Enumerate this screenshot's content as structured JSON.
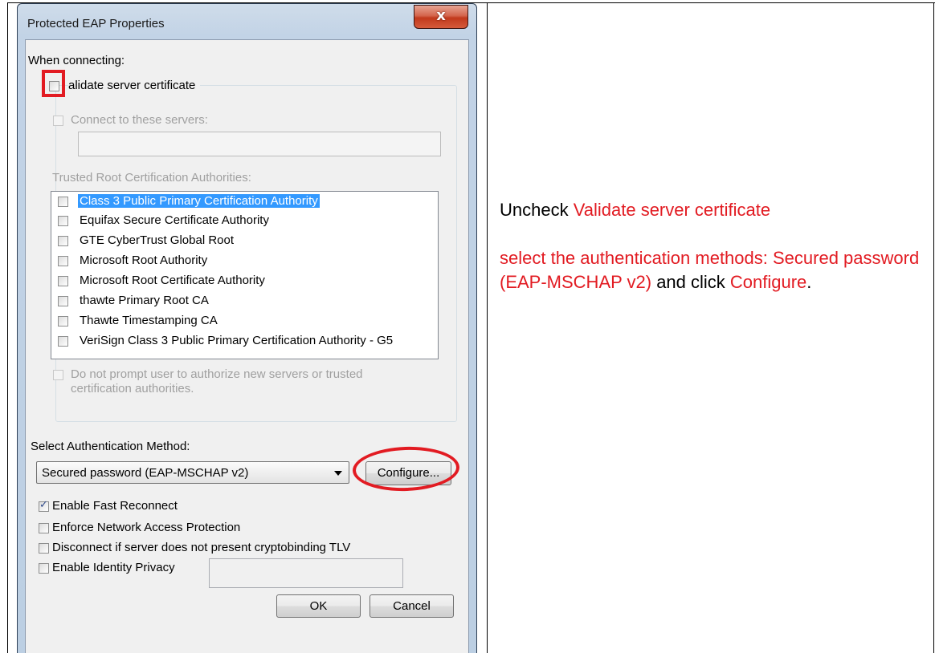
{
  "dialog": {
    "title": "Protected EAP Properties",
    "close_glyph": "x",
    "when_connecting": "When connecting:",
    "validate_cert": {
      "label": "alidate server certificate",
      "checked": false
    },
    "connect_servers": {
      "label": "Connect to these servers:",
      "value": ""
    },
    "trusted_ca_label": "Trusted Root Certification Authorities:",
    "ca_list": [
      {
        "label": "Class 3 Public Primary Certification Authority",
        "checked": false,
        "selected": true
      },
      {
        "label": "Equifax Secure Certificate Authority",
        "checked": false
      },
      {
        "label": "GTE CyberTrust Global Root",
        "checked": false
      },
      {
        "label": "Microsoft Root Authority",
        "checked": false
      },
      {
        "label": "Microsoft Root Certificate Authority",
        "checked": false
      },
      {
        "label": "thawte Primary Root CA",
        "checked": false
      },
      {
        "label": "Thawte Timestamping CA",
        "checked": false
      },
      {
        "label": "VeriSign Class 3 Public Primary Certification Authority - G5",
        "checked": false
      }
    ],
    "no_prompt_line1": "Do not prompt user to authorize new servers or trusted",
    "no_prompt_line2": "certification authorities.",
    "select_method_label": "Select Authentication Method:",
    "method_value": "Secured password (EAP-MSCHAP v2)",
    "configure_label": "Configure...",
    "fast_reconnect": {
      "label": "Enable Fast Reconnect",
      "checked": true
    },
    "enforce_nap": {
      "label": "Enforce Network Access Protection",
      "checked": false
    },
    "disconnect_tlv": {
      "label": "Disconnect if server does not present cryptobinding TLV",
      "checked": false
    },
    "identity_privacy": {
      "label": "Enable Identity Privacy",
      "checked": false,
      "value": ""
    },
    "ok_label": "OK",
    "cancel_label": "Cancel"
  },
  "instructions": {
    "p1_prefix": "Uncheck ",
    "p1_highlight": "Validate server certificate",
    "p2_highlight": "select the authentication methods: Secured password (EAP-MSCHAP v2)",
    "p2_mid": " and click ",
    "p2_highlight2": "Configure",
    "p2_end": "."
  },
  "colors": {
    "highlight_red": "#e21b22",
    "selection_blue": "#3399ff"
  }
}
